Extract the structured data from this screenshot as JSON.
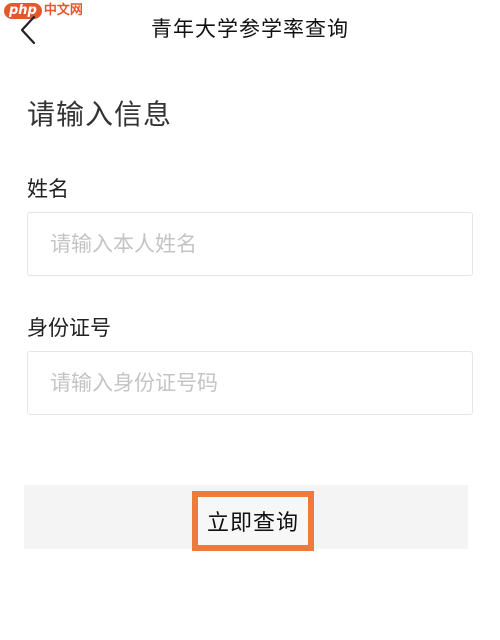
{
  "watermark": {
    "prefix": "php",
    "site": "中文网"
  },
  "header": {
    "title": "青年大学参学率查询",
    "back_icon": "chevron-left-icon"
  },
  "form": {
    "section_title": "请输入信息",
    "name_label": "姓名",
    "name_placeholder": "请输入本人姓名",
    "name_value": "",
    "id_label": "身份证号",
    "id_placeholder": "请输入身份证号码",
    "id_value": ""
  },
  "submit": {
    "label": "立即查询",
    "highlight_color": "#f07a3a"
  }
}
